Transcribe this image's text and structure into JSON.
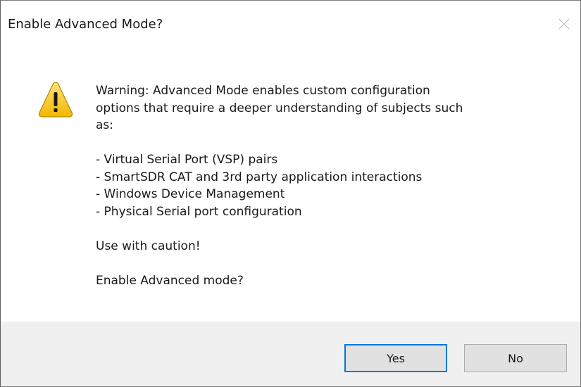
{
  "window": {
    "title": "Enable Advanced Mode?",
    "close_icon": "close-icon"
  },
  "message": {
    "icon": "warning-icon",
    "intro_lines": [
      "Warning: Advanced Mode enables custom configuration",
      "options that require a deeper understanding of subjects such",
      "as:"
    ],
    "items": [
      "- Virtual Serial Port (VSP) pairs",
      "- SmartSDR CAT and 3rd party application interactions",
      "- Windows Device Management",
      "- Physical Serial port configuration"
    ],
    "caution": "Use with caution!",
    "question": "Enable Advanced mode?"
  },
  "buttons": {
    "yes_label": "Yes",
    "no_label": "No",
    "default_button_border": "#0078d7"
  },
  "colors": {
    "footer_background": "#f0f0f0",
    "warning_yellow": "#f5c400"
  }
}
